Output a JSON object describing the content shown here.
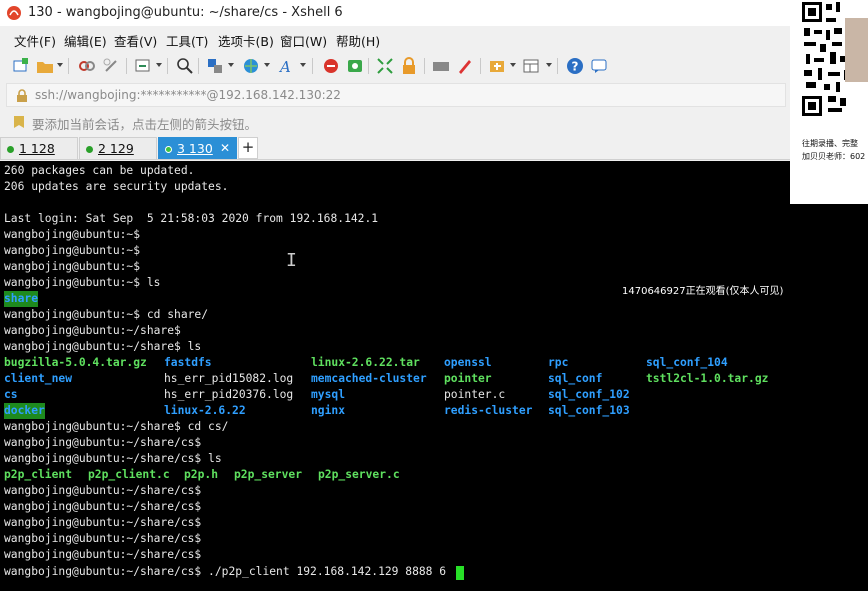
{
  "window": {
    "title": "130 - wangbojing@ubuntu: ~/share/cs - Xshell 6"
  },
  "menu": {
    "items": [
      "文件(F)",
      "编辑(E)",
      "查看(V)",
      "工具(T)",
      "选项卡(B)",
      "窗口(W)",
      "帮助(H)"
    ]
  },
  "address": {
    "text": "ssh://wangbojing:***********@192.168.142.130:22"
  },
  "hint": {
    "text": "要添加当前会话，点击左侧的箭头按钮。"
  },
  "tabs": [
    {
      "label": "1 128",
      "active": false
    },
    {
      "label": "2 129",
      "active": false
    },
    {
      "label": "3 130",
      "active": true
    }
  ],
  "tab_add_label": "+",
  "tab_close_label": "✕",
  "terminal": {
    "lines": [
      "260 packages can be updated.",
      "206 updates are security updates.",
      "",
      "Last login: Sat Sep  5 21:58:03 2020 from 192.168.142.1",
      "wangbojing@ubuntu:~$",
      "wangbojing@ubuntu:~$",
      "wangbojing@ubuntu:~$",
      "wangbojing@ubuntu:~$ ls",
      "",
      "wangbojing@ubuntu:~$ cd share/",
      "wangbojing@ubuntu:~/share$",
      "wangbojing@ubuntu:~/share$ ls",
      "",
      "",
      "",
      "",
      "wangbojing@ubuntu:~/share$ cd cs/",
      "wangbojing@ubuntu:~/share/cs$",
      "wangbojing@ubuntu:~/share/cs$ ls",
      "",
      "wangbojing@ubuntu:~/share/cs$",
      "wangbojing@ubuntu:~/share/cs$",
      "wangbojing@ubuntu:~/share/cs$",
      "wangbojing@ubuntu:~/share/cs$",
      "wangbojing@ubuntu:~/share/cs$",
      "wangbojing@ubuntu:~/share/cs$ ./p2p_client 192.168.142.129 8888 6"
    ],
    "home_ls": [
      "share"
    ],
    "share_ls": [
      [
        "bugzilla-5.0.4.tar.gz",
        "fastdfs",
        "linux-2.6.22.tar",
        "openssl",
        "rpc",
        "sql_conf_104"
      ],
      [
        "client_new",
        "hs_err_pid15082.log",
        "memcached-cluster",
        "pointer",
        "sql_conf",
        "tstl2cl-1.0.tar.gz"
      ],
      [
        "cs",
        "hs_err_pid20376.log",
        "mysql",
        "pointer.c",
        "sql_conf_102",
        ""
      ],
      [
        "docker",
        "linux-2.6.22",
        "nginx",
        "redis-cluster",
        "sql_conf_103",
        ""
      ]
    ],
    "cs_ls": [
      "p2p_client",
      "p2p_client.c",
      "p2p.h",
      "p2p_server",
      "p2p_server.c"
    ]
  },
  "overlay": {
    "viewer_note": "1470646927正在观看(仅本人可见)",
    "qr_caption_1": "往期录播、完整",
    "qr_caption_2": "加贝贝老师：602"
  },
  "colors": {
    "terminal_bg": "#000000",
    "dir_blue": "#2f9fff",
    "exec_green": "#5fe05f",
    "archive_red": "#ff5555",
    "tab_active": "#2b8fd6"
  }
}
